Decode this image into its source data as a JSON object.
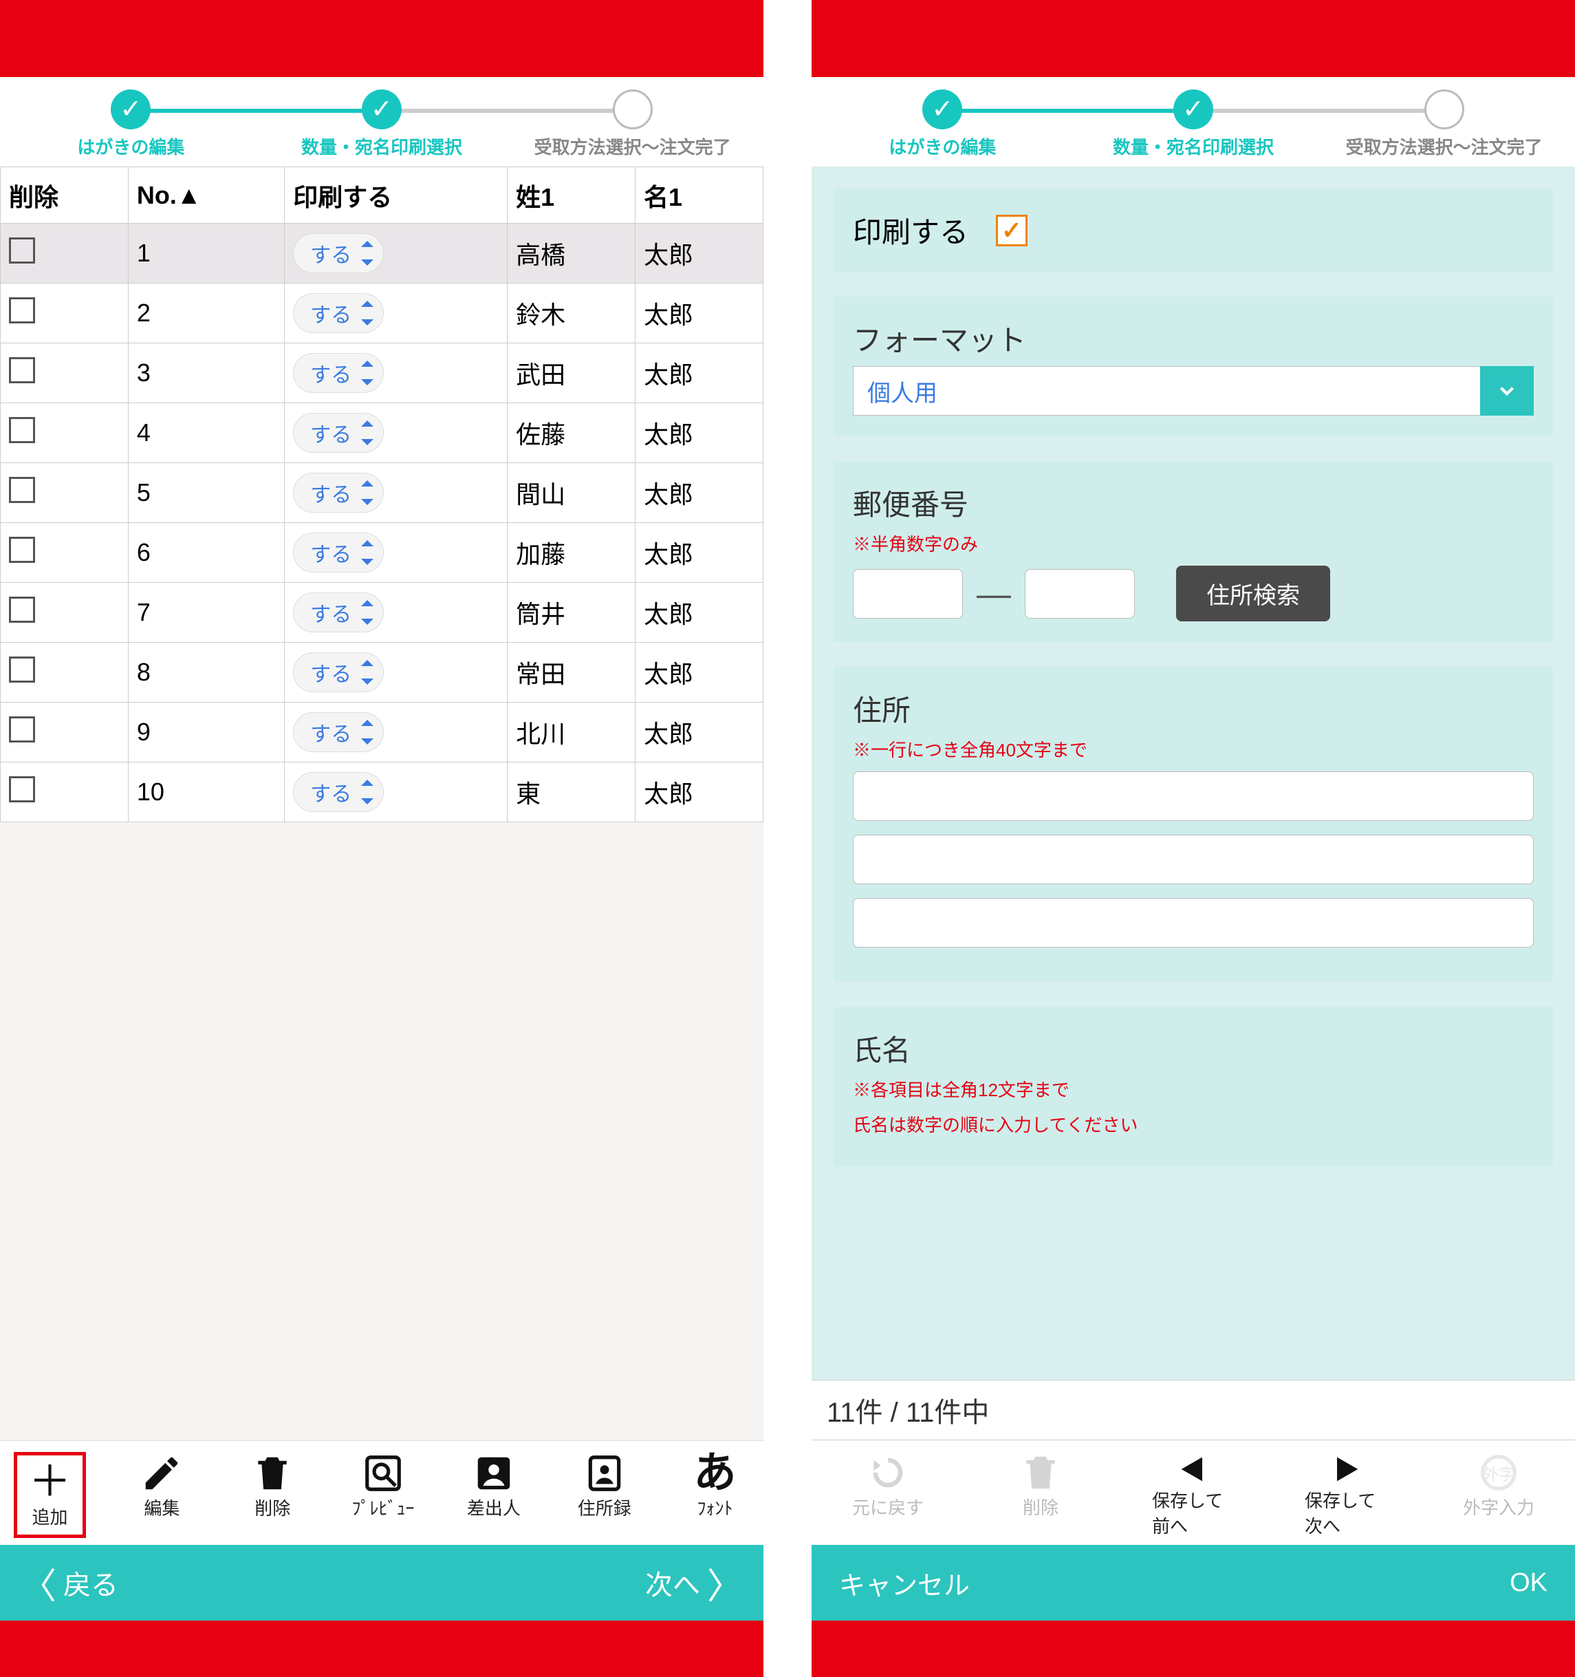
{
  "progress": {
    "steps": [
      {
        "label": "はがきの編集",
        "done": true
      },
      {
        "label": "数量・宛名印刷選択",
        "done": true
      },
      {
        "label": "受取方法選択～注文完了",
        "done": false
      }
    ]
  },
  "left": {
    "columns": {
      "del": "削除",
      "no": "No.▲",
      "print": "印刷する",
      "sei": "姓1",
      "mei": "名1"
    },
    "print_option": "する",
    "rows": [
      {
        "no": "1",
        "sei": "高橋",
        "mei": "太郎",
        "selected": true
      },
      {
        "no": "2",
        "sei": "鈴木",
        "mei": "太郎"
      },
      {
        "no": "3",
        "sei": "武田",
        "mei": "太郎"
      },
      {
        "no": "4",
        "sei": "佐藤",
        "mei": "太郎"
      },
      {
        "no": "5",
        "sei": "間山",
        "mei": "太郎"
      },
      {
        "no": "6",
        "sei": "加藤",
        "mei": "太郎"
      },
      {
        "no": "7",
        "sei": "筒井",
        "mei": "太郎"
      },
      {
        "no": "8",
        "sei": "常田",
        "mei": "太郎"
      },
      {
        "no": "9",
        "sei": "北川",
        "mei": "太郎"
      },
      {
        "no": "10",
        "sei": "東",
        "mei": "太郎"
      }
    ],
    "toolbar": {
      "add": "追加",
      "edit": "編集",
      "delete": "削除",
      "preview": "ﾌﾟﾚﾋﾞｭｰ",
      "sender": "差出人",
      "addrbook": "住所録",
      "font": "ﾌｫﾝﾄ"
    },
    "nav": {
      "back": "戻る",
      "next": "次へ"
    }
  },
  "right": {
    "print_label": "印刷する",
    "format": {
      "title": "フォーマット",
      "value": "個人用"
    },
    "zip": {
      "title": "郵便番号",
      "hint": "※半角数字のみ",
      "search": "住所検索"
    },
    "address": {
      "title": "住所",
      "hint": "※一行につき全角40文字まで"
    },
    "name": {
      "title": "氏名",
      "hint1": "※各項目は全角12文字まで",
      "hint2": "氏名は数字の順に入力してください"
    },
    "status": "11件 / 11件中",
    "toolbar": {
      "undo": "元に戻す",
      "delete": "削除",
      "prev": "保存して前へ",
      "next": "保存して次へ",
      "gaiji": "外字入力"
    },
    "bottom": {
      "cancel": "キャンセル",
      "ok": "OK"
    }
  }
}
